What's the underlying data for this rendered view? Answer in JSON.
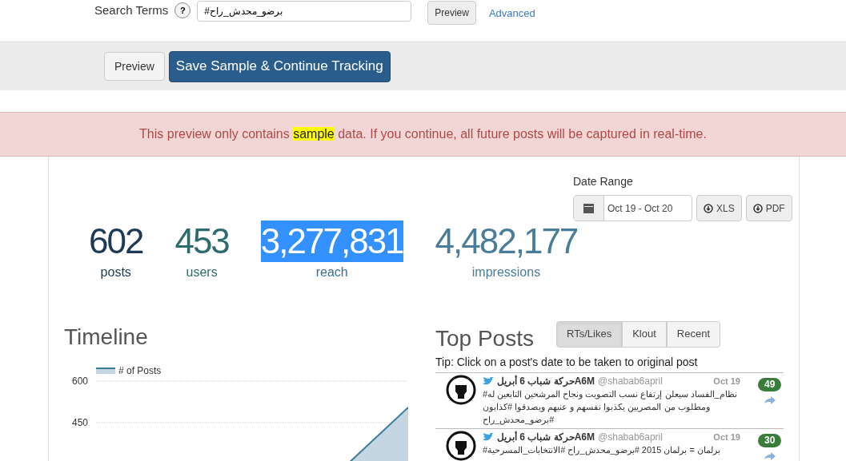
{
  "search": {
    "label": "Search Terms",
    "help": "?",
    "value": "#برضو_محدش_راح",
    "preview_button": "Preview",
    "advanced_link": "Advanced"
  },
  "actions": {
    "preview_button": "Preview",
    "save_button": "Save Sample & Continue Tracking"
  },
  "alert": {
    "text_before": "This preview only contains ",
    "highlight": "sample",
    "text_after": " data. If you continue, all future posts will be captured in real-time."
  },
  "date_range": {
    "label": "Date Range",
    "value": "Oct 19 - Oct 20",
    "xls_button": "XLS",
    "pdf_button": "PDF"
  },
  "stats": [
    {
      "value": "602",
      "label": "posts",
      "color": "#1c3a57",
      "highlighted": false
    },
    {
      "value": "453",
      "label": "users",
      "color": "#2c6b6e",
      "highlighted": false
    },
    {
      "value": "3,277,831",
      "label": "reach",
      "color": "#3b6f8f",
      "highlighted": true
    },
    {
      "value": "4,482,177",
      "label": "impressions",
      "color": "#4a7d99",
      "highlighted": false
    }
  ],
  "timeline": {
    "title": "Timeline",
    "legend": "# of Posts",
    "y_labels": [
      "600",
      "450"
    ]
  },
  "top_posts": {
    "title": "Top Posts",
    "tabs": [
      {
        "label": "RTs/Likes",
        "selected": true
      },
      {
        "label": "Klout",
        "selected": false
      },
      {
        "label": "Recent",
        "selected": false
      }
    ],
    "tip": "Tip: Click on a post's date to be taken to original post",
    "posts": [
      {
        "name": "حركة شباب 6 أبريلA6M",
        "handle": "@shabab6april",
        "date": "Oct 19",
        "text": "#نظام_الفساد سيعلن إرتفاع نسب التصويت ونجاح المرشحين التابعين له ومطلوب من المصريين يكذبوا نفسهم و عنيهم ويصدقوا #كذابون #برضو_محدش_راح",
        "count": "49"
      },
      {
        "name": "حركة شباب 6 أبريلA6M",
        "handle": "@shabab6april",
        "date": "Oct 19",
        "text": "#برلمان = برلمان 2015 #برضو_محدش_راح #الانتخابات_المسرحية",
        "count": "30"
      }
    ]
  }
}
